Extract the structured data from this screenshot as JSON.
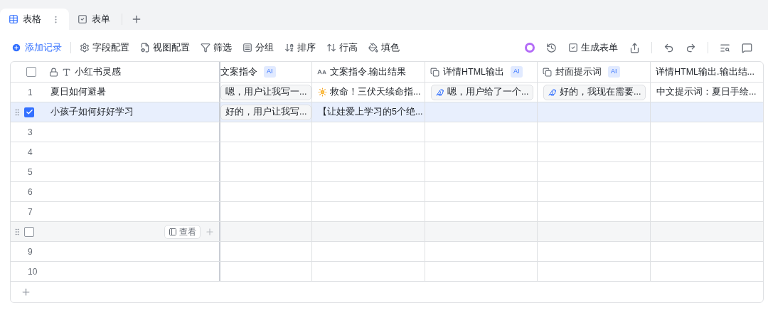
{
  "tabs": [
    {
      "label": "表格",
      "kind": "grid",
      "selected": true
    },
    {
      "label": "表单",
      "kind": "form",
      "selected": false
    }
  ],
  "toolbar": {
    "add_record": "添加记录",
    "items": [
      {
        "label": "字段配置",
        "kind": "settings"
      },
      {
        "label": "视图配置",
        "kind": "view"
      },
      {
        "label": "筛选",
        "kind": "filter"
      },
      {
        "label": "分组",
        "kind": "group"
      },
      {
        "label": "排序",
        "kind": "sort"
      },
      {
        "label": "行高",
        "kind": "height"
      },
      {
        "label": "填色",
        "kind": "fill"
      }
    ],
    "generate_form": "生成表单"
  },
  "table": {
    "select_all_checked": false,
    "primary_column": {
      "label": "小红书灵感",
      "locked": true
    },
    "columns": [
      {
        "label": "文案指令",
        "kind": "plain",
        "badge": "AI"
      },
      {
        "label": "文案指令.输出结果",
        "kind": "extract"
      },
      {
        "label": "详情HTML输出",
        "kind": "ai-ref",
        "badge": "AI"
      },
      {
        "label": "封面提示词",
        "kind": "ai-ref",
        "badge": "AI"
      },
      {
        "label": "详情HTML输出.输出结...",
        "kind": "plain"
      }
    ],
    "rows": [
      {
        "number": "1",
        "selected": false,
        "hovered": false,
        "name": "夏日如何避暑",
        "cells": [
          {
            "kind": "chip",
            "text": "嗯，用户让我写一..."
          },
          {
            "kind": "sun-text",
            "text": "救命！三伏天续命指..."
          },
          {
            "kind": "ai-chip",
            "text": "嗯，用户给了一个..."
          },
          {
            "kind": "ai-chip",
            "text": "好的，我现在需要..."
          },
          {
            "kind": "text",
            "text": "中文提示词：夏日手绘..."
          }
        ]
      },
      {
        "selected": true,
        "hovered": false,
        "name": "小孩子如何好好学习",
        "cells": [
          {
            "kind": "chip",
            "text": "好的，用户让我写..."
          },
          {
            "kind": "text",
            "text": "【让娃爱上学习的5个绝..."
          }
        ]
      },
      {
        "number": "3",
        "selected": false,
        "hovered": false
      },
      {
        "number": "4",
        "selected": false,
        "hovered": false
      },
      {
        "number": "5",
        "selected": false,
        "hovered": false
      },
      {
        "number": "6",
        "selected": false,
        "hovered": false
      },
      {
        "number": "7",
        "selected": false,
        "hovered": false
      },
      {
        "selected": false,
        "hovered": true,
        "open_label": "查看"
      },
      {
        "number": "9",
        "selected": false,
        "hovered": false
      },
      {
        "number": "10",
        "selected": false,
        "hovered": false
      }
    ]
  }
}
